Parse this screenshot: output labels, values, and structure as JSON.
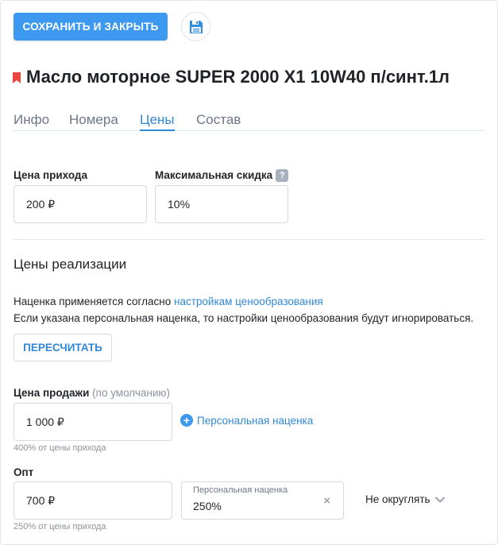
{
  "toolbar": {
    "save_close_label": "СОХРАНИТЬ И ЗАКРЫТЬ",
    "save_icon": "floppy-disk-icon"
  },
  "product": {
    "title": "Масло моторное SUPER 2000 X1 10W40 п/синт.1л",
    "marker_icon": "bookmark-icon",
    "marker_color": "#e8453c"
  },
  "tabs": [
    {
      "label": "Инфо",
      "active": false
    },
    {
      "label": "Номера",
      "active": false
    },
    {
      "label": "Цены",
      "active": true
    },
    {
      "label": "Состав",
      "active": false
    }
  ],
  "purchase": {
    "price_label": "Цена прихода",
    "price_value": "200 ₽",
    "max_discount_label": "Максимальная скидка",
    "max_discount_value": "10%",
    "help_glyph": "?"
  },
  "sales": {
    "section_title": "Цены реализации",
    "info_line1_prefix": "Наценка применяется согласно",
    "info_line1_link": "настройкам ценообразования",
    "info_line2": "Если указана персональная наценка, то настройки ценообразования будут игнорироваться.",
    "recalculate_label": "ПЕРЕСЧИТАТЬ"
  },
  "sale_price": {
    "label": "Цена продажи",
    "default_note": "(по умолчанию)",
    "value": "1 000 ₽",
    "add_markup_label": "Персональная наценка",
    "add_icon": "plus-circle-icon",
    "hint": "400% от цены прихода"
  },
  "wholesale": {
    "label": "Опт",
    "value": "700 ₽",
    "markup_label": "Персональная наценка",
    "markup_value": "250%",
    "clear_glyph": "×",
    "rounding_label": "Не округлять",
    "hint": "250% от цены прихода"
  },
  "colors": {
    "accent": "#3d98f0",
    "link": "#3189d9",
    "muted": "#8a949e"
  }
}
